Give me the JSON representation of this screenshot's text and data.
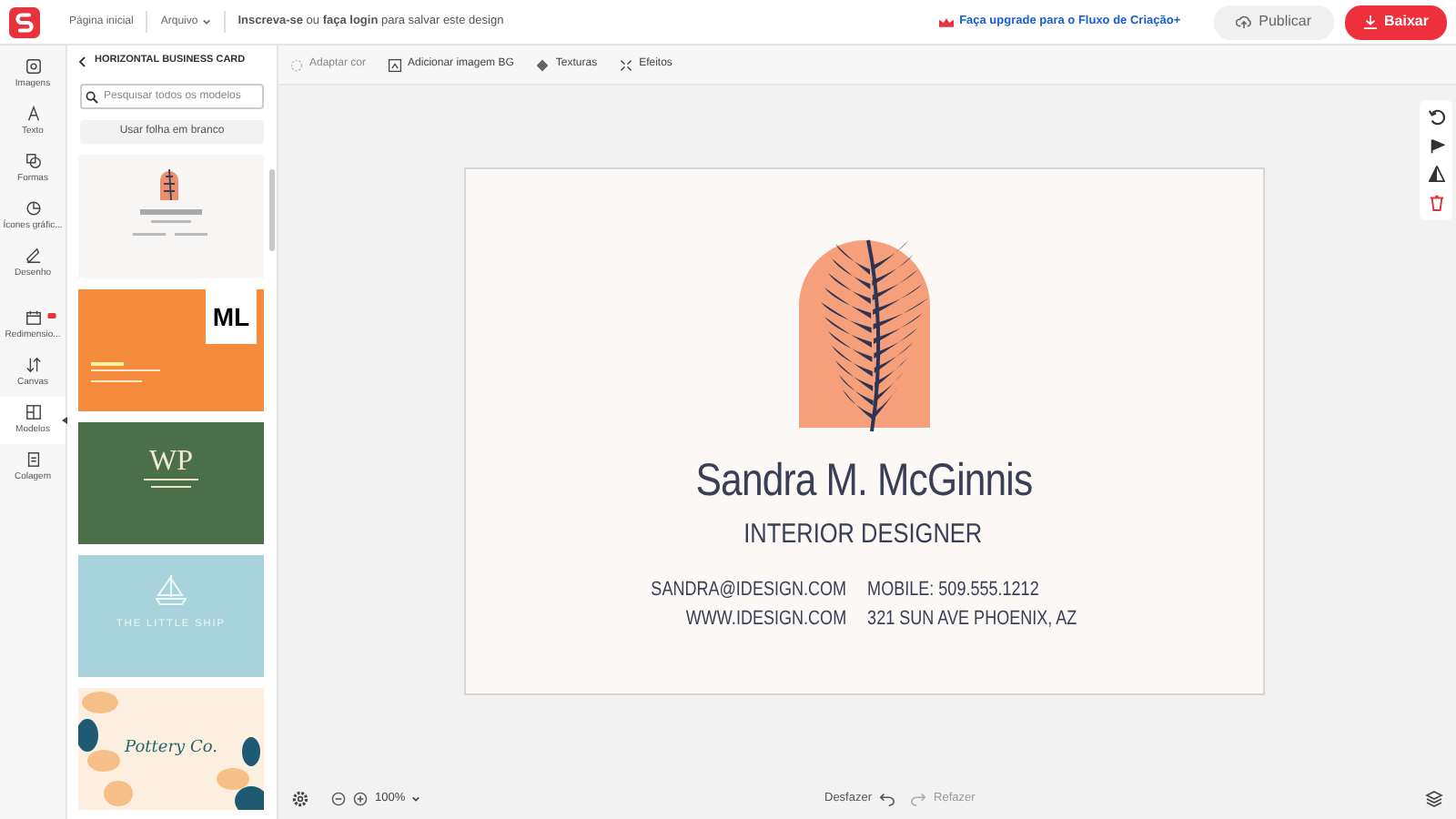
{
  "topbar": {
    "home": "Página inicial",
    "file_menu": "Arquivo",
    "signup": "**Inscreva-se** ou **faça login** para salvar este design",
    "upgrade": "Faça upgrade para o Fluxo de Criação+",
    "publish": "Publicar",
    "download": "Baixar"
  },
  "rail": [
    {
      "label": "Imagens",
      "selected": false,
      "flagged": false,
      "kind": "image"
    },
    {
      "label": "Texto",
      "selected": false,
      "flagged": false,
      "kind": "text"
    },
    {
      "label": "Formas",
      "selected": false,
      "flagged": false,
      "kind": "shapes"
    },
    {
      "label": "Ícones gráfic...",
      "selected": false,
      "flagged": false,
      "kind": "graphic"
    },
    {
      "label": "Desenho",
      "selected": false,
      "flagged": false,
      "kind": "draw"
    },
    {
      "label": "Redimensio...",
      "selected": false,
      "flagged": true,
      "kind": "resize"
    },
    {
      "label": "Canvas",
      "selected": false,
      "flagged": false,
      "kind": "canvas"
    },
    {
      "label": "Modelos",
      "selected": true,
      "flagged": false,
      "kind": "templates"
    },
    {
      "label": "Colagem",
      "selected": false,
      "flagged": false,
      "kind": "collage"
    }
  ],
  "panel": {
    "title": "HORIZONTAL BUSINESS CARD",
    "search": {
      "placeholder": "Pesquisar todos os modelos"
    },
    "blank_button": "Usar folha em branco",
    "templates": [
      {
        "kind": "sandra"
      },
      {
        "kind": "ml",
        "text": "ML"
      },
      {
        "kind": "wp",
        "text": "WP"
      },
      {
        "kind": "ship",
        "text": "THE LITTLE SHIP"
      },
      {
        "kind": "pottery",
        "text": "Pottery Co."
      }
    ]
  },
  "toolbar": [
    {
      "label": "Adaptar cor",
      "kind": "color",
      "disabled": true
    },
    {
      "label": "Adicionar imagem BG",
      "kind": "bg",
      "disabled": false
    },
    {
      "label": "Texturas",
      "kind": "texture",
      "disabled": false
    },
    {
      "label": "Efeitos",
      "kind": "effects",
      "disabled": false
    }
  ],
  "card": {
    "name": "Sandra M. McGinnis",
    "role": "INTERIOR DESIGNER",
    "email": "SANDRA@IDESIGN.COM",
    "website": "WWW.IDESIGN.COM",
    "phone": "MOBILE: 509.555.1212",
    "address": "321 SUN AVE PHOENIX, AZ"
  },
  "bottom": {
    "zoom": "100%",
    "undo": {
      "label": "Desfazer",
      "disabled": false
    },
    "redo": {
      "label": "Refazer",
      "disabled": true
    }
  }
}
